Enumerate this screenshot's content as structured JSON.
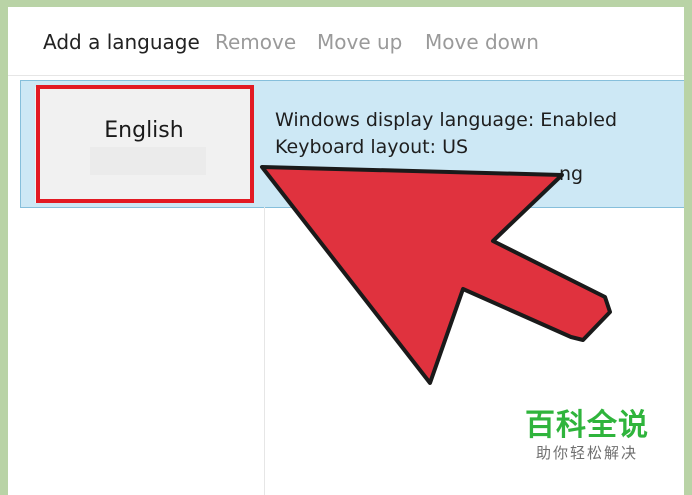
{
  "toolbar": {
    "add_label": "Add a language",
    "remove_label": "Remove",
    "move_up_label": "Move up",
    "move_down_label": "Move down"
  },
  "language_list": {
    "items": [
      {
        "name": "English",
        "details": [
          "Windows display language: Enabled",
          "Keyboard layout: US",
          "ng"
        ]
      }
    ]
  },
  "annotation": {
    "highlight_color": "#e21a23",
    "arrow_color": "#e0323e",
    "arrow_icon": "pointer-arrow-icon"
  },
  "watermark": {
    "title": "百科全说",
    "subtitle": "助你轻松解决",
    "title_color": "#2fb43c"
  }
}
